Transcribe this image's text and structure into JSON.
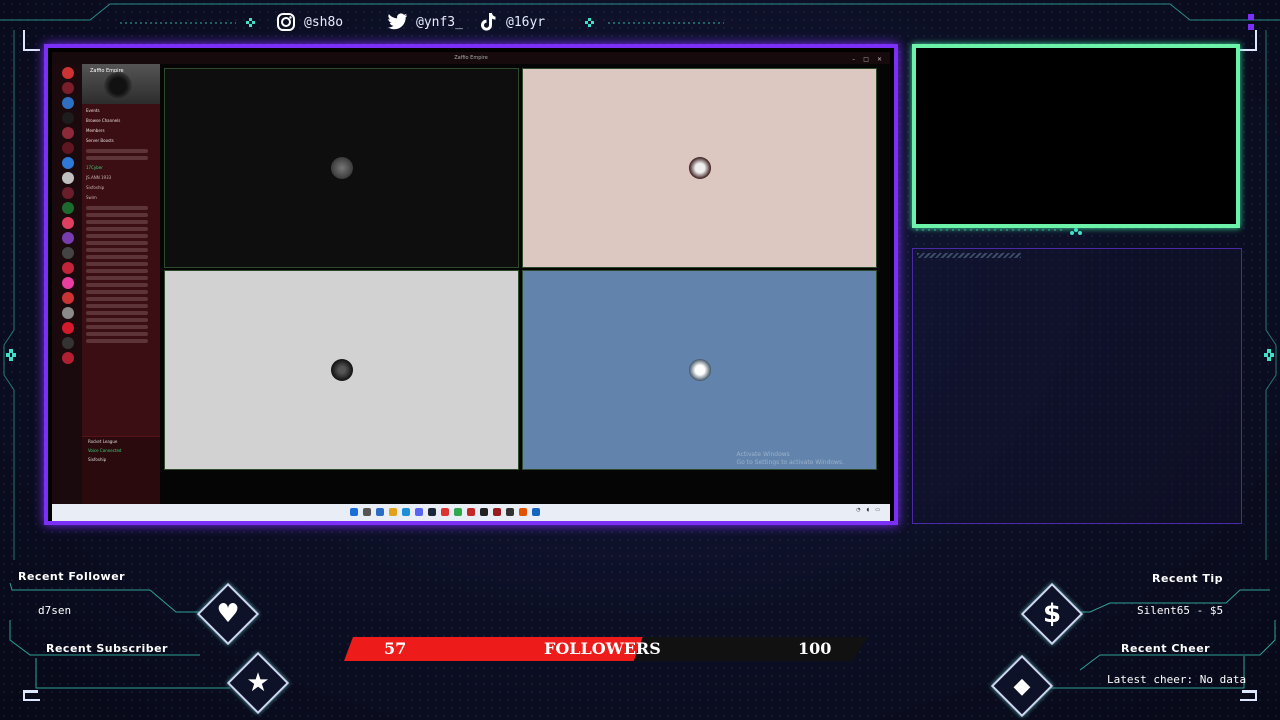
{
  "social": {
    "instagram": "@sh8o",
    "twitter": "@ynf3_",
    "tiktok": "@16yr"
  },
  "app": {
    "window_title": "Zaffio Empire",
    "server_name": "Zaffio Empire",
    "channels": [
      "Events",
      "Browse Channels",
      "Members",
      "Server Boosts"
    ],
    "voice_users": [
      "17Cyber",
      "JS.ANN 1933",
      "Sixfoship",
      "Swim"
    ],
    "game_activity": "Rocket League",
    "voice_status": "Voice Connected",
    "user_name": "Sixfoship",
    "watermark_title": "Activate Windows",
    "watermark_sub": "Go to Settings to activate Windows."
  },
  "widgets": {
    "recent_follower_label": "Recent Follower",
    "recent_follower_value": "d7sen",
    "recent_subscriber_label": "Recent Subscriber",
    "recent_tip_label": "Recent Tip",
    "recent_tip_value": "Silent65 - $5",
    "recent_cheer_label": "Recent Cheer",
    "recent_cheer_value": "Latest cheer: No data"
  },
  "followers_goal": {
    "current": "57",
    "label": "FOLLOWERS",
    "target": "100",
    "progress": 0.57
  },
  "colors": {
    "frame_purple": "#7b2ff7",
    "cam_green": "#6cf2a9",
    "accent_teal": "#3fe0c8",
    "goal_red": "#ee1b1b"
  },
  "icons": [
    "instagram-icon",
    "twitter-icon",
    "tiktok-icon",
    "heart-icon",
    "star-icon",
    "dollar-icon",
    "diamond-icon"
  ]
}
